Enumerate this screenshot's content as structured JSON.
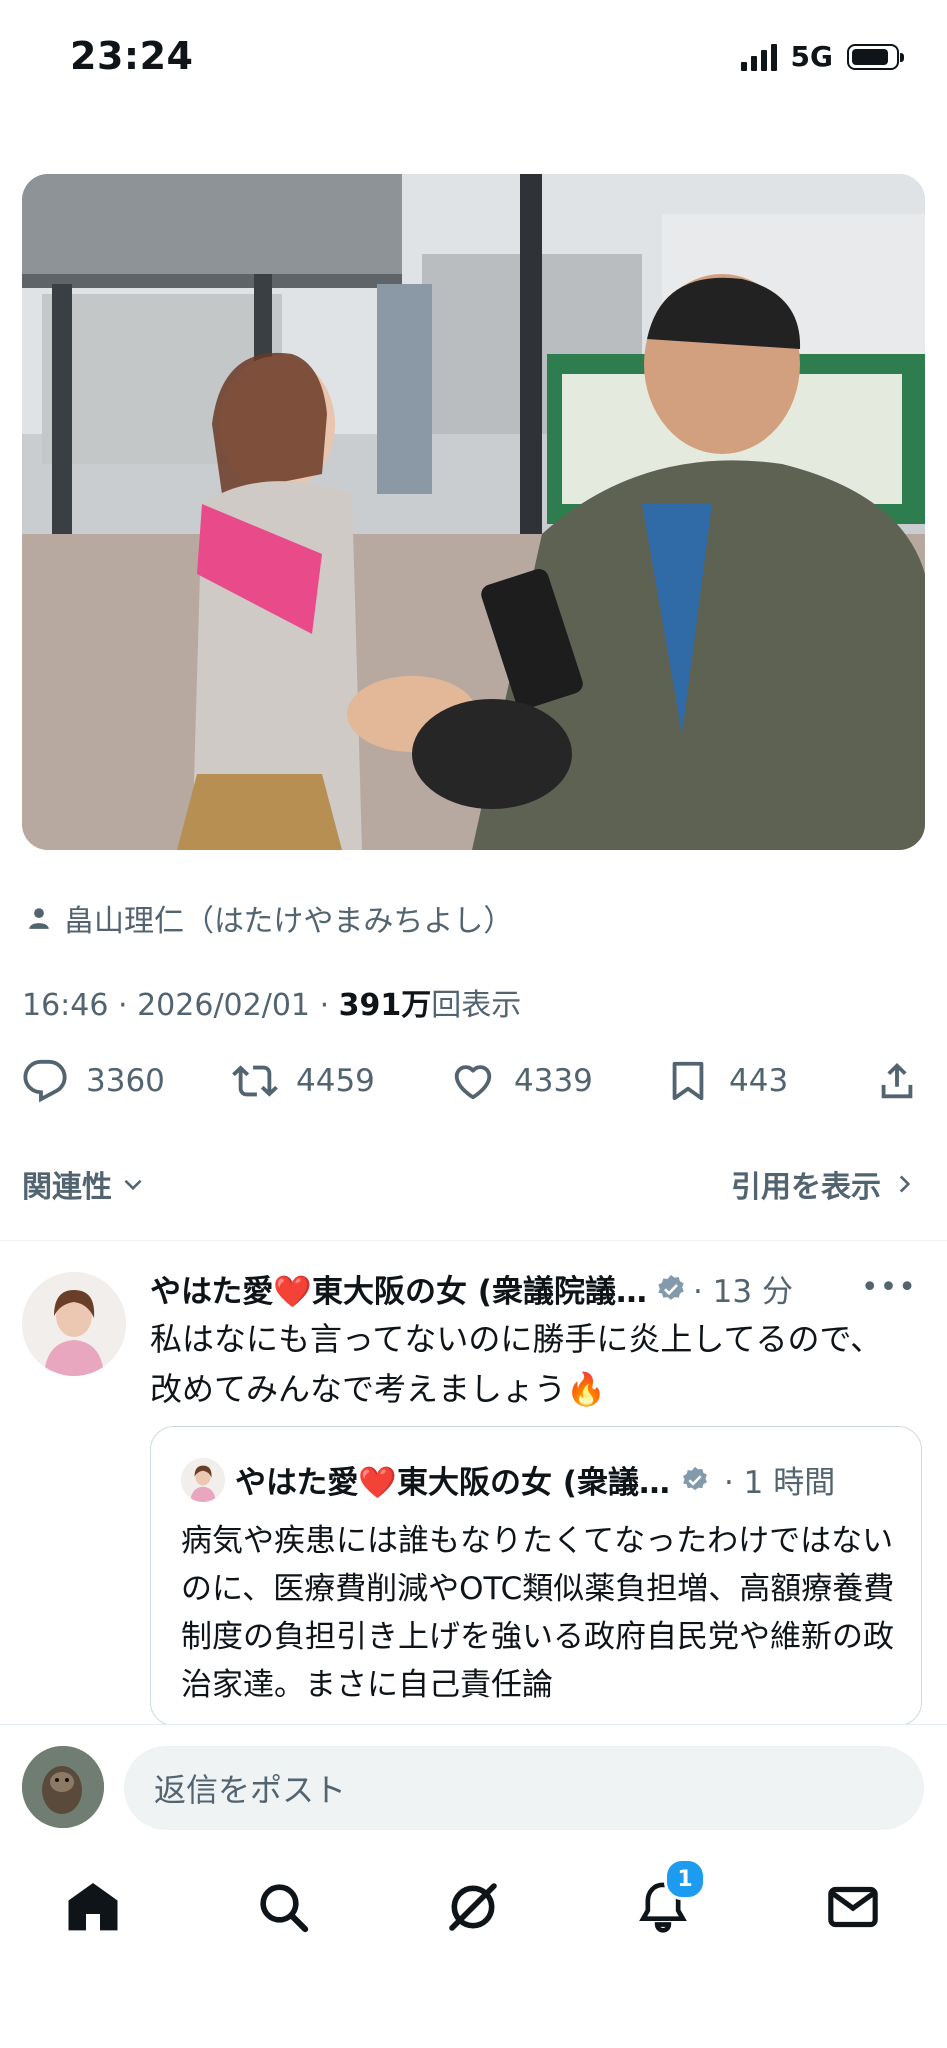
{
  "status_bar": {
    "time": "23:24",
    "network": "5G",
    "battery_level": 0.75
  },
  "post": {
    "author_line": "畠山理仁（はたけやまみちよし）",
    "meta": {
      "time": "16:46",
      "date": "2026/02/01",
      "views": "391万",
      "views_suffix": "回表示"
    },
    "actions": {
      "replies": "3360",
      "reposts": "4459",
      "likes": "4339",
      "bookmarks": "443"
    }
  },
  "relevance": {
    "sort_label": "関連性",
    "quote_link": "引用を表示"
  },
  "reply": {
    "name": "やはた愛❤️東大阪の女 (衆議院議…",
    "time": "· 13 分",
    "more": "•••",
    "text": "私はなにも言ってないのに勝手に炎上してるので、改めてみんなで考えましょう🔥",
    "quote": {
      "name": "やはた愛❤️東大阪の女 (衆議…",
      "time": "· 1 時間",
      "text": "病気や疾患には誰もなりたくてなったわけではないのに、医療費削減やOTC類似薬負担増、高額療養費制度の負担引き上げを強いる政府自民党や維新の政治家達。まさに自己責任論"
    }
  },
  "composer": {
    "placeholder": "返信をポスト"
  },
  "tabbar": {
    "notification_count": "1"
  },
  "colors": {
    "accent": "#1d9bf0",
    "text": "#0f1419",
    "secondary": "#536471"
  }
}
